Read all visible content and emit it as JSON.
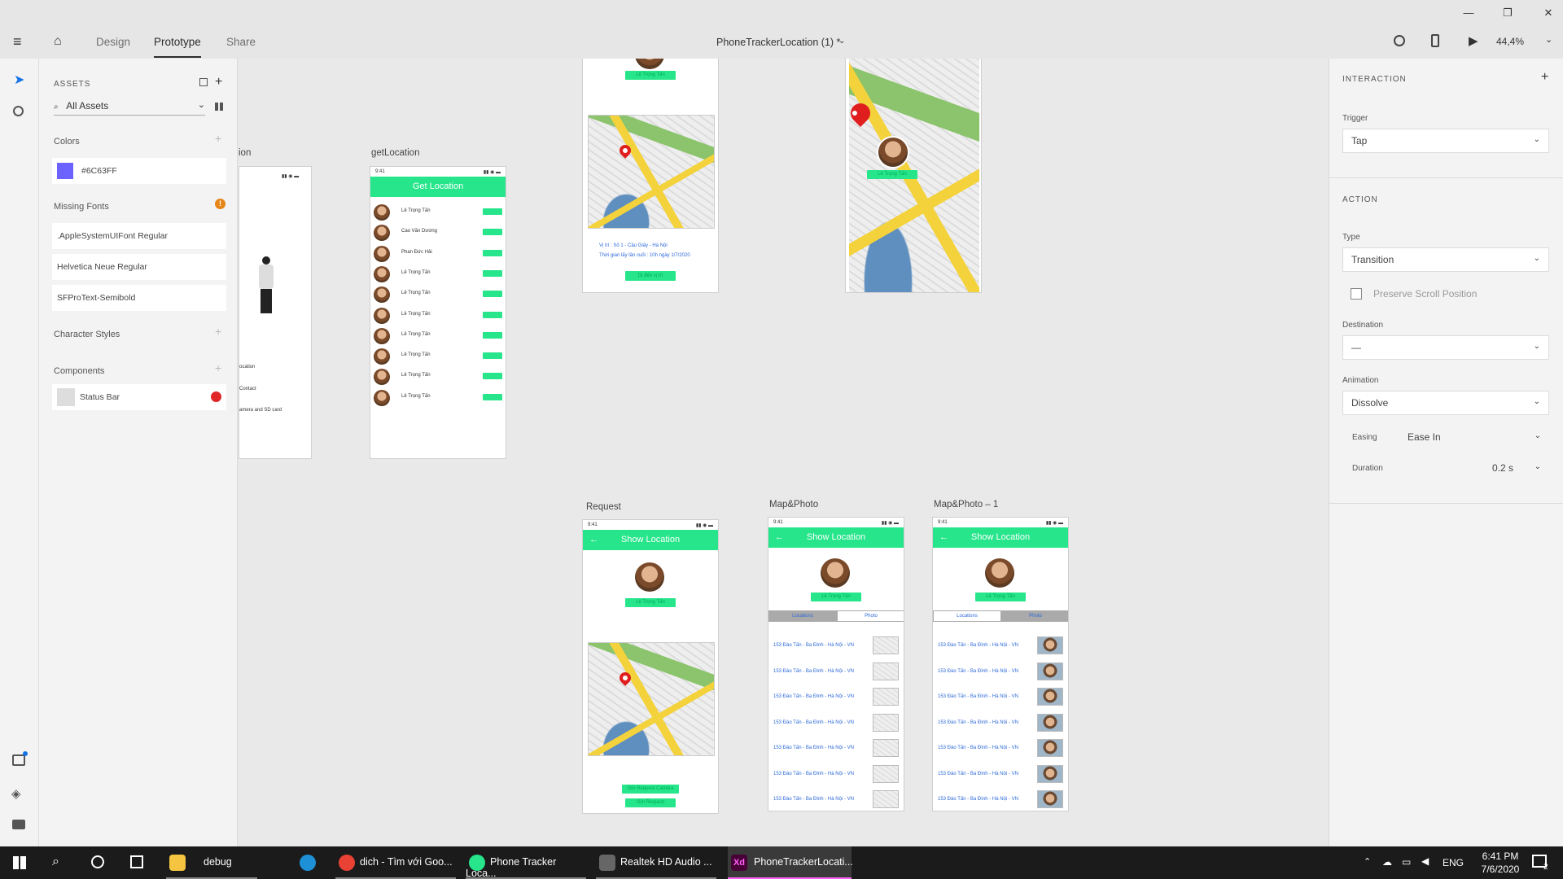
{
  "app": {
    "menu_icon": "hamburger-icon",
    "home_icon": "home-icon",
    "tabs": [
      "Design",
      "Prototype",
      "Share"
    ],
    "active_tab": "Prototype",
    "doc_title": "PhoneTrackerLocation (1) *",
    "zoom": "44,4%",
    "accent": "#26e58a"
  },
  "assets": {
    "header": "ASSETS",
    "search": "All Assets",
    "colors_label": "Colors",
    "color_hex": "#6C63FF",
    "missing_fonts_label": "Missing Fonts",
    "fonts": [
      ".AppleSystemUIFont Regular",
      "Helvetica Neue Regular",
      "SFProText-Semibold"
    ],
    "char_styles_label": "Character Styles",
    "components_label": "Components",
    "component": "Status Bar"
  },
  "canvas": {
    "frame0_label": "ion",
    "frame0_items": [
      "ocation",
      "Contact",
      "amera and SD card"
    ],
    "getloc": {
      "label": "getLocation",
      "time": "9:41",
      "title": "Get Location",
      "people": [
        "Lê Trọng Tấn",
        "Cao Văn Dương",
        "Phan Đức Hải",
        "Lê Trọng Tấn",
        "Lê Trọng Tấn",
        "Lê Trọng Tấn",
        "Lê Trọng Tấn",
        "Lê Trọng Tấn",
        "Lê Trọng Tấn",
        "Lê Trọng Tấn"
      ]
    },
    "top_mid": {
      "name": "Lê Trọng Tấn",
      "loc": "Vị trí : Số 1 - Cầu Giấy - Hà Nội",
      "time": "Thời gian lấy lần cuối :   10h ngày 1/7/2020",
      "btn": "Di đến vị trí"
    },
    "top_right": {
      "name": "Lê Trọng Tấn"
    },
    "request": {
      "label": "Request",
      "time": "9:41",
      "title": "Show Location",
      "name": "Lê Trọng Tấn",
      "btn1": "Gửi Request Camera",
      "btn2": "Gửi Request"
    },
    "mp": {
      "label": "Map&Photo",
      "time": "9:41",
      "title": "Show Location",
      "name": "Lê Trọng Tấn",
      "tab1": "Locations",
      "tab2": "Photo",
      "row": "153 Đào Tấn - Ba Đình - Hà Nội - VN"
    },
    "mp1": {
      "label": "Map&Photo – 1",
      "time": "9:41",
      "title": "Show Location",
      "name": "Lê Trọng Tấn",
      "tab1": "Locations",
      "tab2": "Photo",
      "row": "153 Đào Tấn - Ba Đình - Hà Nội - VN"
    }
  },
  "inspector": {
    "header": "INTERACTION",
    "trigger_label": "Trigger",
    "trigger": "Tap",
    "action_header": "ACTION",
    "type_label": "Type",
    "type": "Transition",
    "preserve": "Preserve Scroll Position",
    "dest_label": "Destination",
    "dest": "—",
    "anim_label": "Animation",
    "anim": "Dissolve",
    "easing_label": "Easing",
    "easing": "Ease In",
    "duration_label": "Duration",
    "duration": "0.2 s"
  },
  "taskbar": {
    "items": [
      "debug",
      "dich - Tìm với Goo...",
      "Phone Tracker Loca...",
      "Realtek HD Audio ...",
      "PhoneTrackerLocati..."
    ],
    "lang": "ENG",
    "clock_time": "6:41 PM",
    "clock_date": "7/6/2020",
    "notif": "2"
  }
}
